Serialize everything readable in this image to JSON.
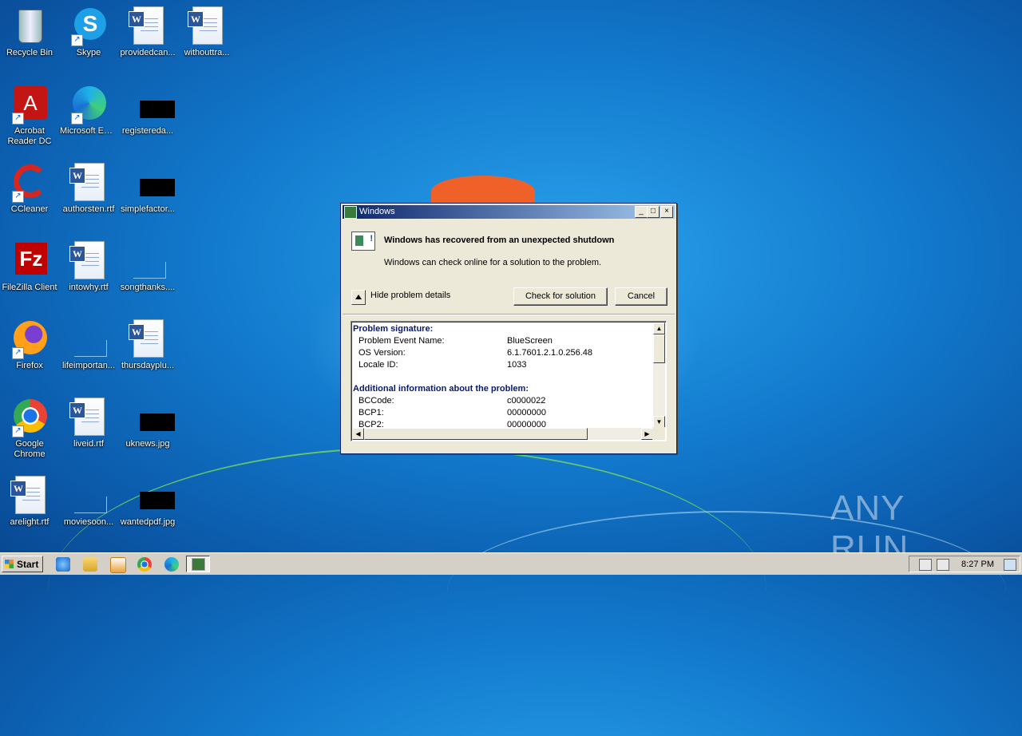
{
  "desktop": {
    "icons": [
      {
        "label": "Recycle Bin"
      },
      {
        "label": "Skype"
      },
      {
        "label": "providedcan..."
      },
      {
        "label": "withouttra..."
      },
      {
        "label": "Acrobat Reader DC"
      },
      {
        "label": "Microsoft Edge"
      },
      {
        "label": "registereda..."
      },
      {
        "label": "CCleaner"
      },
      {
        "label": "authorsten.rtf"
      },
      {
        "label": "simplefactor..."
      },
      {
        "label": "FileZilla Client"
      },
      {
        "label": "intowhy.rtf"
      },
      {
        "label": "songthanks...."
      },
      {
        "label": "Firefox"
      },
      {
        "label": "lifeimportan..."
      },
      {
        "label": "thursdayplu..."
      },
      {
        "label": "Google Chrome"
      },
      {
        "label": "liveid.rtf"
      },
      {
        "label": "uknews.jpg"
      },
      {
        "label": "arelight.rtf"
      },
      {
        "label": "moviesoon..."
      },
      {
        "label": "wantedpdf.jpg"
      }
    ]
  },
  "dialog": {
    "title": "Windows",
    "title_buttons": {
      "minimize": "_",
      "maximize": "□",
      "close": "×"
    },
    "heading": "Windows has recovered from an unexpected shutdown",
    "subtext": "Windows can check online for a solution to the problem.",
    "toggle_label": "Hide problem details",
    "check_button": "Check for solution",
    "cancel_button": "Cancel",
    "details": {
      "section1_title": "Problem signature:",
      "section1_rows": [
        {
          "key": "Problem Event Name:",
          "value": "BlueScreen"
        },
        {
          "key": "OS Version:",
          "value": "6.1.7601.2.1.0.256.48"
        },
        {
          "key": "Locale ID:",
          "value": "1033"
        }
      ],
      "section2_title": "Additional information about the problem:",
      "section2_rows": [
        {
          "key": "BCCode:",
          "value": "c0000022"
        },
        {
          "key": "BCP1:",
          "value": "00000000"
        },
        {
          "key": "BCP2:",
          "value": "00000000"
        }
      ]
    }
  },
  "taskbar": {
    "start_label": "Start",
    "clock": "8:27 PM"
  },
  "watermark": "ANY RUN",
  "colors": {
    "title_bar_start": "#0a246a",
    "title_bar_end": "#a6caf0",
    "section_title": "#0a1a6a",
    "desktop_blue": "#1279cc"
  }
}
